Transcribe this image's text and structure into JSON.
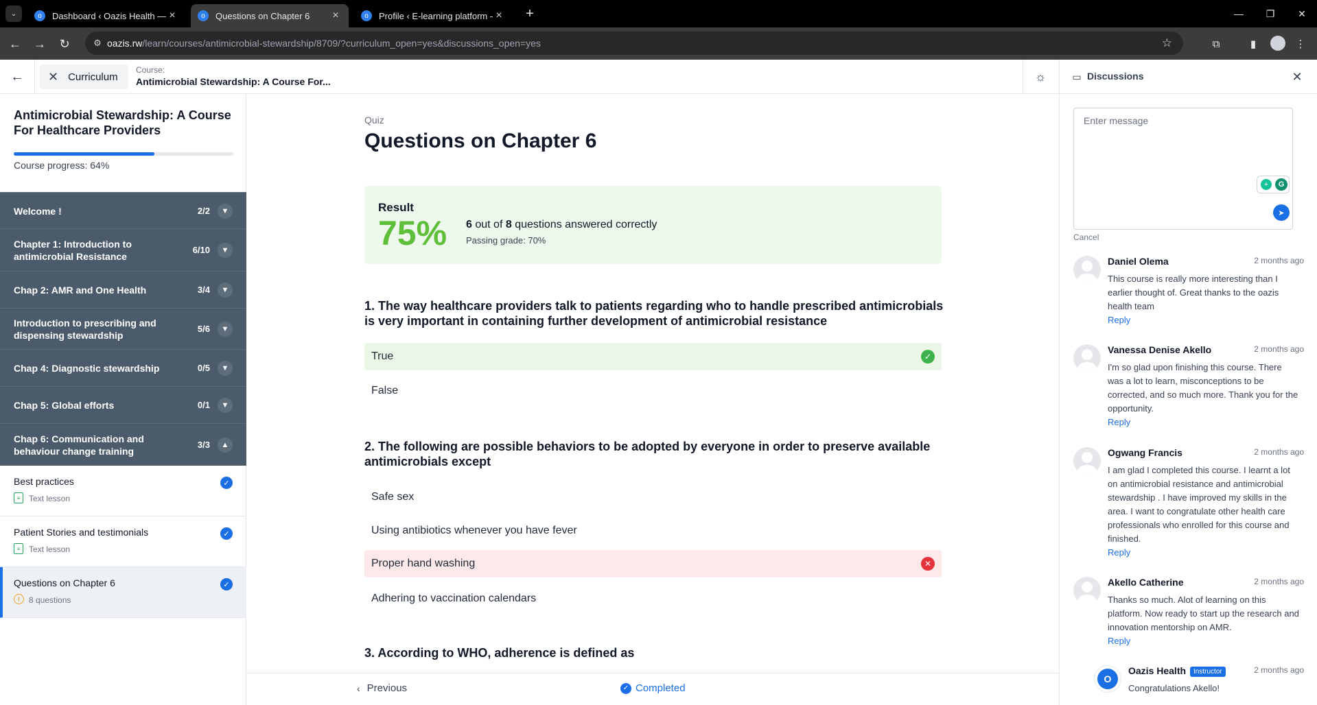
{
  "browser": {
    "tabs": [
      {
        "label": "Dashboard ‹ Oazis Health — W",
        "active": false
      },
      {
        "label": "Questions on Chapter 6",
        "active": true
      },
      {
        "label": "Profile ‹ E-learning platform —",
        "active": false
      }
    ],
    "url_host": "oazis.rw",
    "url_path": "/learn/courses/antimicrobial-stewardship/8709/?curriculum_open=yes&discussions_open=yes"
  },
  "header": {
    "curriculum_label": "Curriculum",
    "course_label": "Course:",
    "course_name": "Antimicrobial Stewardship: A Course For..."
  },
  "sidebar": {
    "title": "Antimicrobial Stewardship: A Course For Healthcare Providers",
    "progress_percent": 64,
    "progress_text": "Course progress: 64%",
    "sections": [
      {
        "title": "Welcome !",
        "count": "2/2",
        "expanded": false
      },
      {
        "title": "Chapter 1: Introduction to antimicrobial Resistance",
        "count": "6/10",
        "expanded": false
      },
      {
        "title": "Chap 2: AMR and One Health",
        "count": "3/4",
        "expanded": false
      },
      {
        "title": "Introduction to prescribing and dispensing stewardship",
        "count": "5/6",
        "expanded": false
      },
      {
        "title": "Chap 4: Diagnostic stewardship",
        "count": "0/5",
        "expanded": false
      },
      {
        "title": "Chap 5: Global efforts",
        "count": "0/1",
        "expanded": false
      },
      {
        "title": "Chap 6: Communication and behaviour change training",
        "count": "3/3",
        "expanded": true
      }
    ],
    "lessons": [
      {
        "title": "Best practices",
        "type": "Text lesson",
        "icon": "document-icon",
        "completed": true
      },
      {
        "title": "Patient Stories and testimonials",
        "type": "Text lesson",
        "icon": "document-icon",
        "completed": true
      },
      {
        "title": "Questions on Chapter 6",
        "type": "8 questions",
        "icon": "quiz-icon",
        "completed": true,
        "active": true
      }
    ]
  },
  "quiz": {
    "label": "Quiz",
    "title": "Questions on Chapter 6",
    "result": {
      "label": "Result",
      "percent": "75%",
      "correct": "6",
      "out_of_text": "out of",
      "total": "8",
      "suffix_text": "questions answered correctly",
      "passing_grade": "Passing grade: 70%"
    },
    "questions": [
      {
        "text": "1. The way healthcare providers talk to patients regarding who to handle prescribed antimicrobials is very important in containing further development of antimicrobial resistance",
        "answers": [
          {
            "text": "True",
            "state": "correct"
          },
          {
            "text": "False",
            "state": "none"
          }
        ]
      },
      {
        "text": "2. The following are possible behaviors to be adopted by everyone in order to preserve available antimicrobials except",
        "answers": [
          {
            "text": "Safe sex",
            "state": "none"
          },
          {
            "text": "Using antibiotics whenever you have fever",
            "state": "none"
          },
          {
            "text": "Proper hand washing",
            "state": "wrong"
          },
          {
            "text": "Adhering to vaccination calendars",
            "state": "none"
          }
        ]
      },
      {
        "text": "3. According to WHO, adherence is defined as",
        "answers": []
      }
    ]
  },
  "footer": {
    "previous_label": "Previous",
    "completed_label": "Completed"
  },
  "discussions": {
    "title": "Discussions",
    "placeholder": "Enter message",
    "cancel_label": "Cancel",
    "reply_label": "Reply",
    "comments": [
      {
        "name": "Daniel Olema",
        "time": "2 months ago",
        "text": "This course is really more interesting than I earlier thought of. Great thanks to the oazis health team"
      },
      {
        "name": "Vanessa Denise Akello",
        "time": "2 months ago",
        "text": "I'm so glad upon finishing this course. There was a lot to learn, misconceptions to be corrected, and so much more. Thank you for the opportunity."
      },
      {
        "name": "Ogwang Francis",
        "time": "2 months ago",
        "text": "I am glad I completed this course. I learnt a lot on antimicrobial resistance and antimicrobial stewardship . I have improved my skills in the area. I want to congratulate other health care professionals who enrolled for this course and finished."
      },
      {
        "name": "Akello Catherine",
        "time": "2 months ago",
        "text": "Thanks so much. Alot of learning on this platform. Now ready to start up the research and innovation mentorship on AMR."
      }
    ],
    "reply": {
      "name": "Oazis Health",
      "badge": "Instructor",
      "time": "2 months ago",
      "text": "Congratulations Akello!"
    }
  }
}
